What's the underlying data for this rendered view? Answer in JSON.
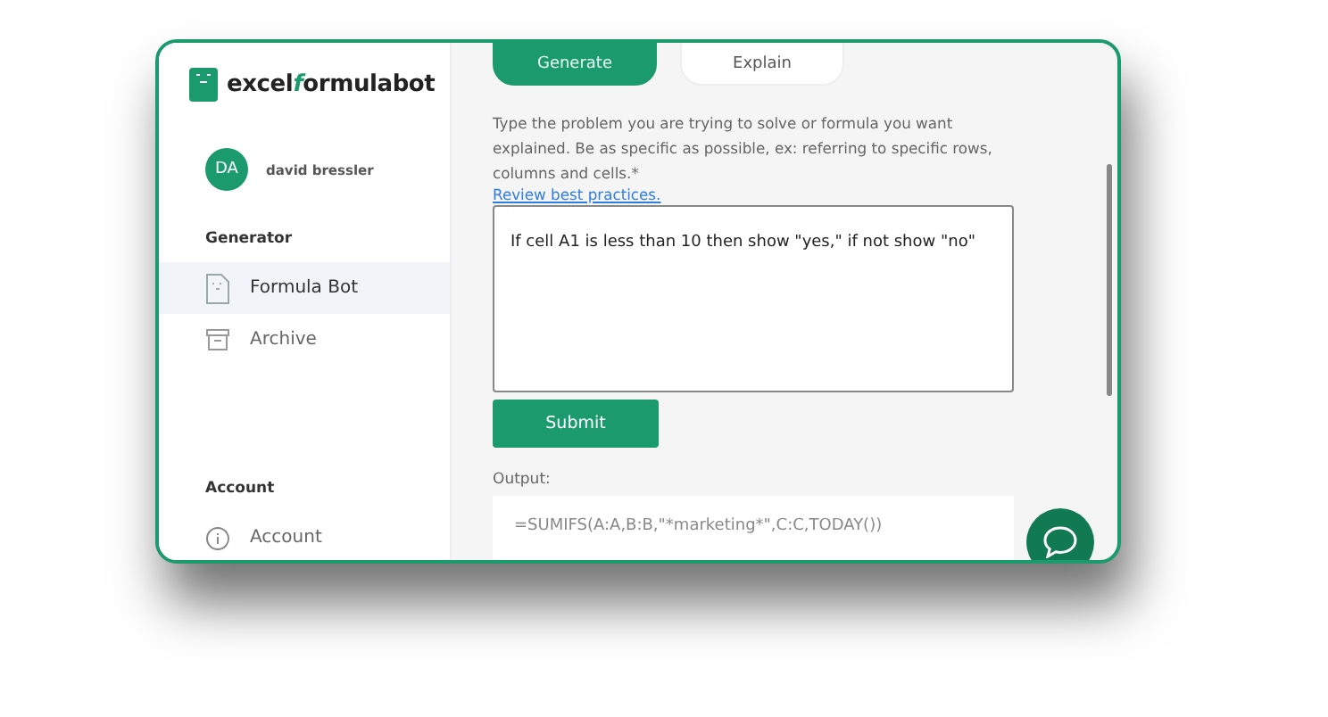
{
  "sidebar": {
    "logo": [
      {
        "text": "excel",
        "accent": false
      },
      {
        "text": "f",
        "accent": true
      },
      {
        "text": "ormulabot",
        "accent": false
      }
    ],
    "user": {
      "initials": "DA",
      "name": "david bressler"
    },
    "sections": [
      {
        "heading": "Generator",
        "items": [
          {
            "label": "Formula Bot",
            "selected": true
          },
          {
            "label": "Archive",
            "selected": false
          }
        ]
      },
      {
        "heading": "Account",
        "items": [
          {
            "label": "Account",
            "selected": false
          }
        ]
      }
    ]
  },
  "main": {
    "tabs": [
      {
        "label": "Generate",
        "selected": true
      },
      {
        "label": "Explain",
        "selected": false
      }
    ],
    "instructions": "Type the problem you are trying to solve or formula you want explained. Be as specific as possible, ex: referring to specific rows, columns and cells.*",
    "link": "Review best practices.",
    "problem": {
      "value": "If cell A1 is less than 10 then show \"yes,\" if not show \"no\""
    },
    "submit": "Submit",
    "output_label": "Output:",
    "output": {
      "value": "=SUMIFS(A:A,B:B,\"*marketing*\",C:C,TODAY())"
    }
  }
}
